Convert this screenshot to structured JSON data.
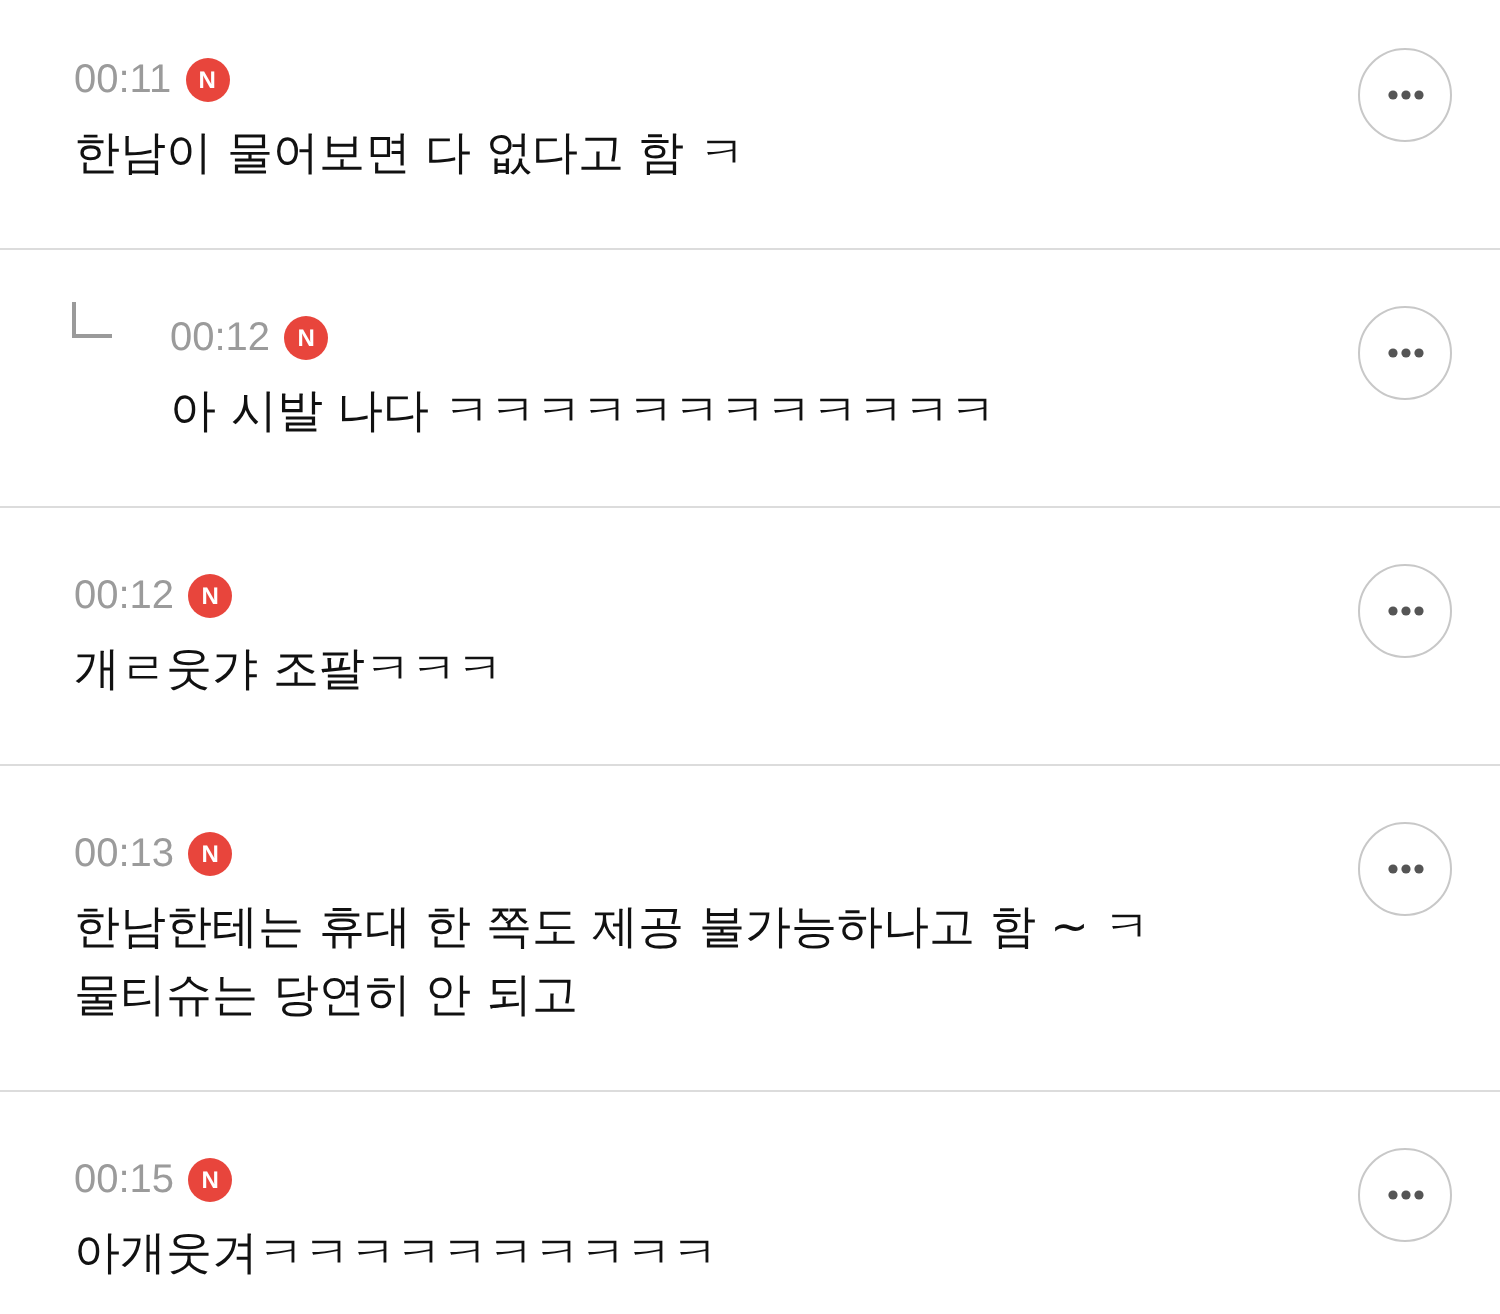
{
  "comments": [
    {
      "time": "00:11",
      "badge": "N",
      "text": "한남이 물어보면 다 없다고 함 ㅋ",
      "children": [
        {
          "time": "00:12",
          "badge": "N",
          "text": "아 시발 나다 ㅋㅋㅋㅋㅋㅋㅋㅋㅋㅋㅋㅋ"
        }
      ]
    },
    {
      "time": "00:12",
      "badge": "N",
      "text": "개ㄹ웃갸 조팔ㅋㅋㅋ"
    },
    {
      "time": "00:13",
      "badge": "N",
      "text": "한남한테는 휴대 한 쪽도 제공 불가능하나고 함 ~ ㅋ\n물티슈는 당연히 안 되고"
    },
    {
      "time": "00:15",
      "badge": "N",
      "text": "아개웃겨ㅋㅋㅋㅋㅋㅋㅋㅋㅋㅋ"
    }
  ]
}
